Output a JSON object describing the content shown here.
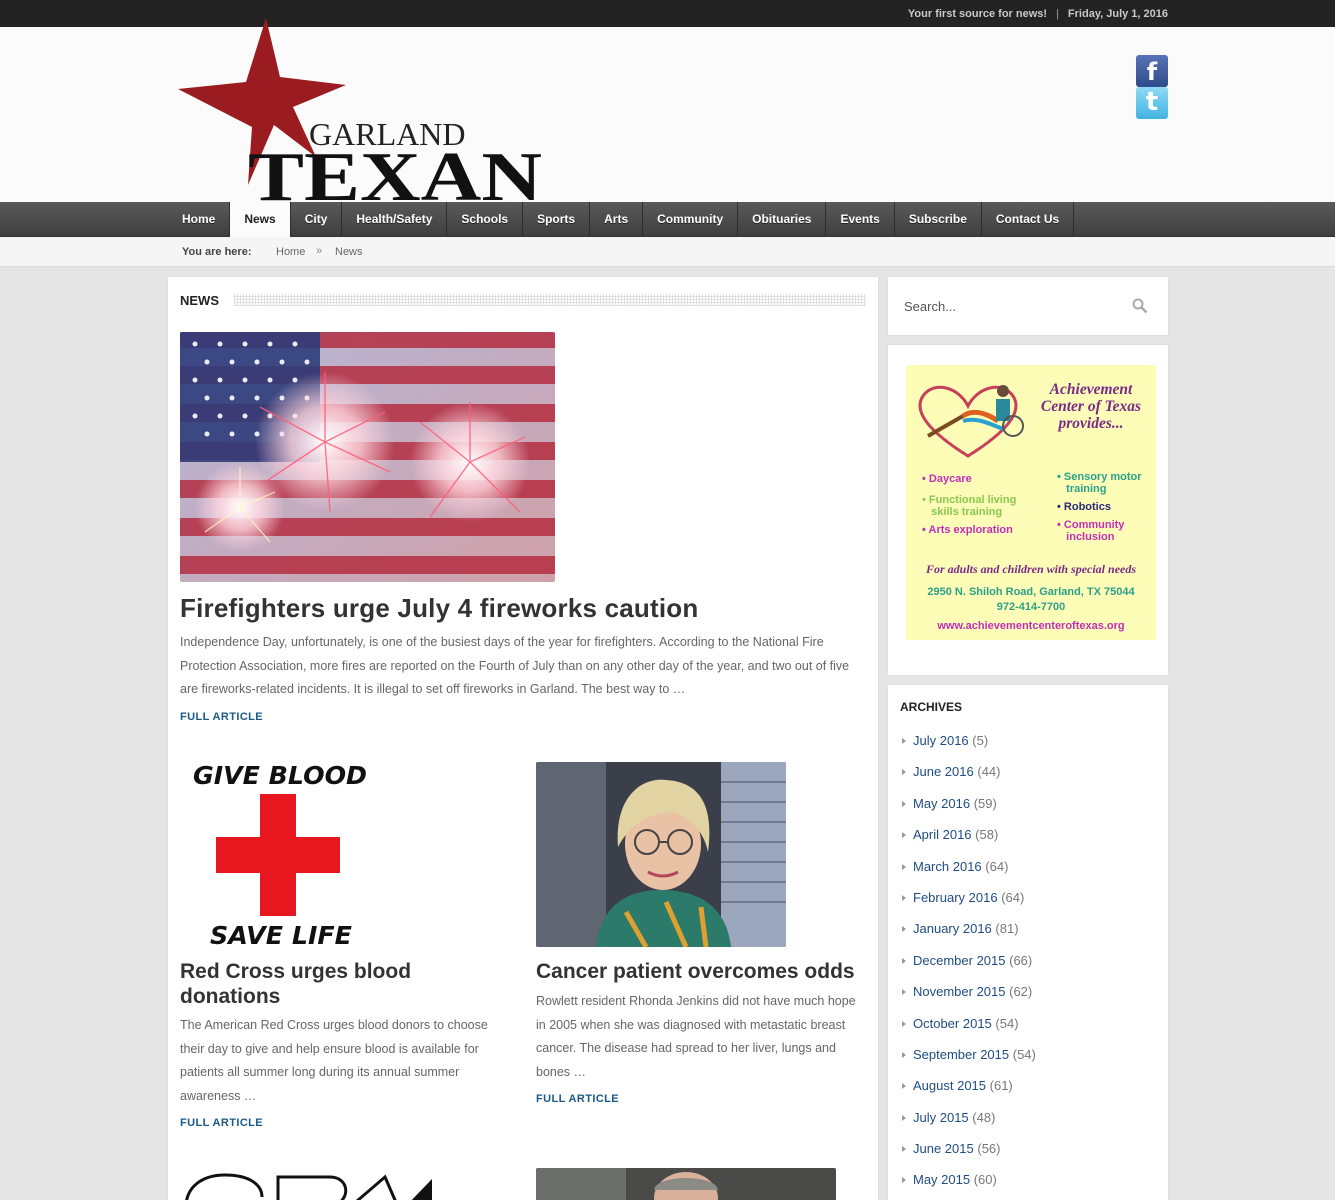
{
  "topbar": {
    "tagline": "Your first source for news!",
    "separator": "|",
    "date": "Friday, July 1, 2016"
  },
  "header": {
    "logo": {
      "line1": "GARLAND",
      "line2": "TEXAN"
    },
    "social": {
      "facebook": "f",
      "twitter": "t"
    }
  },
  "nav": [
    "Home",
    "News",
    "City",
    "Health/Safety",
    "Schools",
    "Sports",
    "Arts",
    "Community",
    "Obituaries",
    "Events",
    "Subscribe",
    "Contact Us"
  ],
  "breadcrumb": {
    "label": "You are here:",
    "home": "Home",
    "separator": "»",
    "current": "News"
  },
  "main": {
    "section_title": "NEWS",
    "articles": [
      {
        "title": "Firefighters urge July 4 fireworks caution",
        "excerpt": "Independence Day, unfortunately, is one of the busiest days of the year for firefighters. According to the National Fire Protection Association, more fires are reported on the Fourth of July than on any other day of the year, and two out of five are fireworks-related incidents. It is illegal to set off fireworks in Garland. The best way to …",
        "more": "FULL ARTICLE"
      },
      {
        "title": "Red Cross urges blood donations",
        "excerpt": "The American Red Cross urges blood donors to choose their day to give and help ensure blood is available for patients all summer long during its annual summer awareness …",
        "more": "FULL ARTICLE",
        "image_text_top": "GIVE BLOOD",
        "image_text_bottom": "SAVE LIFE"
      },
      {
        "title": "Cancer patient overcomes odds",
        "excerpt": "Rowlett resident Rhonda Jenkins did not have much hope in 2005 when she was diagnosed with metastatic breast cancer. The disease had spread to her liver, lungs and bones …",
        "more": "FULL ARTICLE"
      }
    ]
  },
  "sidebar": {
    "search_placeholder": "Search...",
    "ad": {
      "title": "Achievement Center of Texas provides...",
      "items_left": [
        "• Daycare",
        "• Functional living\n   skills training",
        "• Arts exploration"
      ],
      "items_right": [
        "• Sensory motor\n   training",
        "• Robotics",
        "• Community\n   inclusion"
      ],
      "tagline": "For adults and children with special needs",
      "address": "2950 N. Shiloh Road, Garland, TX  75044",
      "phone": "972-414-7700",
      "url": "www.achievementcenteroftexas.org"
    },
    "archives_title": "ARCHIVES",
    "archives": [
      {
        "label": "July 2016",
        "count": "(5)"
      },
      {
        "label": "June 2016",
        "count": "(44)"
      },
      {
        "label": "May 2016",
        "count": "(59)"
      },
      {
        "label": "April 2016",
        "count": "(58)"
      },
      {
        "label": "March 2016",
        "count": "(64)"
      },
      {
        "label": "February 2016",
        "count": "(64)"
      },
      {
        "label": "January 2016",
        "count": "(81)"
      },
      {
        "label": "December 2015",
        "count": "(66)"
      },
      {
        "label": "November 2015",
        "count": "(62)"
      },
      {
        "label": "October 2015",
        "count": "(54)"
      },
      {
        "label": "September 2015",
        "count": "(54)"
      },
      {
        "label": "August 2015",
        "count": "(61)"
      },
      {
        "label": "July 2015",
        "count": "(48)"
      },
      {
        "label": "June 2015",
        "count": "(56)"
      },
      {
        "label": "May 2015",
        "count": "(60)"
      }
    ]
  }
}
